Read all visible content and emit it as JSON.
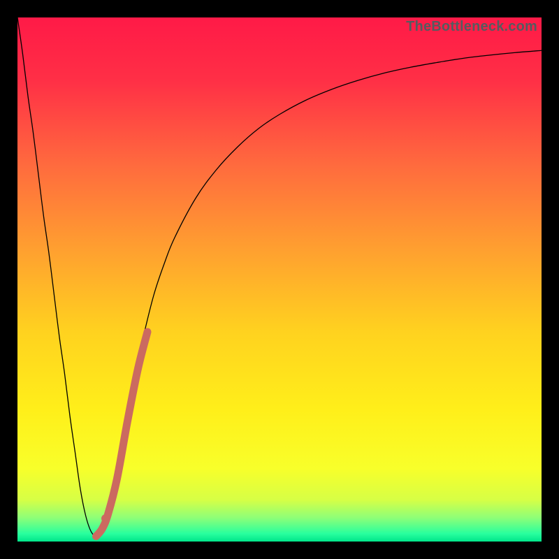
{
  "watermark": "TheBottleneck.com",
  "chart_data": {
    "type": "line",
    "title": "",
    "xlabel": "",
    "ylabel": "",
    "xlim": [
      0,
      100
    ],
    "ylim": [
      0,
      100
    ],
    "grid": false,
    "legend": false,
    "background_gradient_stops": [
      {
        "offset": 0.0,
        "color": "#ff1a47"
      },
      {
        "offset": 0.12,
        "color": "#ff2f46"
      },
      {
        "offset": 0.28,
        "color": "#ff6a3e"
      },
      {
        "offset": 0.45,
        "color": "#ffa22f"
      },
      {
        "offset": 0.6,
        "color": "#ffd21f"
      },
      {
        "offset": 0.75,
        "color": "#ffef1a"
      },
      {
        "offset": 0.86,
        "color": "#f8ff2a"
      },
      {
        "offset": 0.92,
        "color": "#d7ff45"
      },
      {
        "offset": 0.955,
        "color": "#8dff78"
      },
      {
        "offset": 0.985,
        "color": "#28ff9e"
      },
      {
        "offset": 1.0,
        "color": "#00e58a"
      }
    ],
    "series": [
      {
        "name": "bottleneck-curve",
        "stroke": "#000000",
        "stroke_width": 1.3,
        "x": [
          0,
          1,
          2,
          3,
          4,
          5,
          6,
          7,
          8,
          9,
          10,
          11,
          12,
          13,
          14,
          15,
          16,
          17,
          18,
          20,
          22,
          24,
          26,
          28,
          30,
          34,
          38,
          42,
          46,
          50,
          55,
          60,
          65,
          70,
          75,
          80,
          85,
          90,
          95,
          100
        ],
        "y": [
          100,
          93,
          85,
          78,
          70,
          62,
          55,
          47,
          39,
          32,
          24,
          17,
          10,
          5,
          2,
          1,
          2,
          5,
          10,
          20,
          30,
          39,
          47,
          53,
          58,
          65.5,
          71,
          75.3,
          78.8,
          81.5,
          84.2,
          86.3,
          88,
          89.4,
          90.5,
          91.4,
          92.2,
          92.8,
          93.3,
          93.7
        ]
      }
    ],
    "highlight_segment": {
      "name": "highlight-band",
      "stroke": "#cb6a60",
      "stroke_width": 11,
      "linecap": "round",
      "points_xy": [
        [
          15.0,
          1.0
        ],
        [
          16.2,
          2.5
        ],
        [
          17.3,
          5.3
        ],
        [
          19.0,
          12.0
        ],
        [
          21.0,
          23.0
        ],
        [
          23.0,
          33.0
        ],
        [
          24.8,
          40.0
        ]
      ],
      "dot_xy": [
        16.8,
        4.4
      ]
    }
  }
}
